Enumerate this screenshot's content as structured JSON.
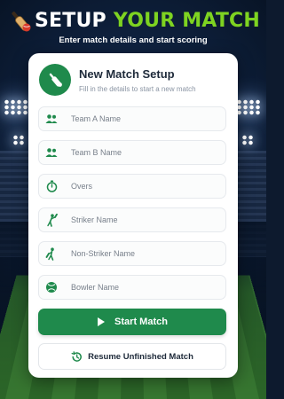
{
  "header": {
    "title_part1": "SETUP",
    "title_part2": "YOUR MATCH",
    "subtitle": "Enter match details and start scoring",
    "icon": "cricket-bat-ball-icon"
  },
  "card": {
    "title": "New Match Setup",
    "subtitle": "Fill in the details to start a new match",
    "icon": "cricket-bat-icon",
    "fields": [
      {
        "placeholder": "Team A Name",
        "value": "",
        "icon": "team-icon"
      },
      {
        "placeholder": "Team B Name",
        "value": "",
        "icon": "team-icon"
      },
      {
        "placeholder": "Overs",
        "value": "",
        "icon": "stopwatch-icon"
      },
      {
        "placeholder": "Striker Name",
        "value": "",
        "icon": "batsman-icon"
      },
      {
        "placeholder": "Non-Striker Name",
        "value": "",
        "icon": "batsman-icon"
      },
      {
        "placeholder": "Bowler Name",
        "value": "",
        "icon": "ball-icon"
      }
    ]
  },
  "actions": {
    "start_label": "Start Match",
    "resume_label": "Resume Unfinished Match"
  },
  "colors": {
    "primary_green": "#1f8a4c",
    "title_accent": "#7ed321",
    "card_bg": "#ffffff",
    "text_dark": "#1e2a3a"
  }
}
